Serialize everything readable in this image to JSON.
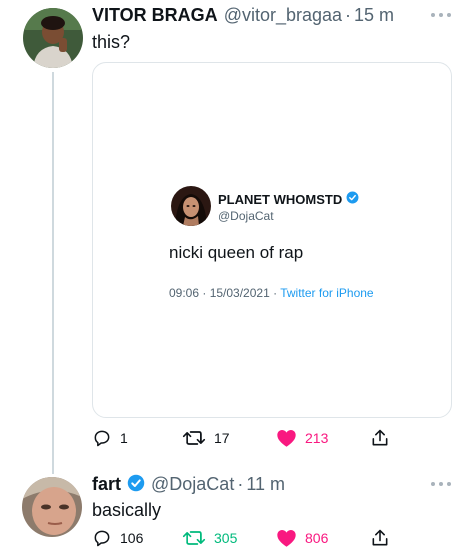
{
  "tweet1": {
    "name": "VITOR BRAGA",
    "handle": "@vitor_bragaa",
    "separator": "·",
    "time": "15 m",
    "text": "this?",
    "quoted": {
      "name": "PLANET WHOMSTD",
      "handle": "@DojaCat",
      "text": "nicki queen of rap",
      "timestamp": "09:06 · 15/03/2021 ·",
      "source": "Twitter for iPhone"
    },
    "actions": {
      "replies": "1",
      "retweets": "17",
      "likes": "213"
    }
  },
  "tweet2": {
    "name": "fart",
    "handle": "@DojaCat",
    "separator": "·",
    "time": "11 m",
    "text": "basically",
    "actions": {
      "replies": "106",
      "retweets": "305",
      "likes": "806"
    }
  },
  "icons": {
    "reply": "reply-icon",
    "retweet": "retweet-icon",
    "like": "heart-icon",
    "share": "share-icon",
    "verified": "verified-badge-icon",
    "more": "more-dots-icon"
  },
  "colors": {
    "verified": "#1d9bf0",
    "like": "#f91880",
    "retweet_active": "#00ba7c",
    "secondary_text": "#536471"
  }
}
